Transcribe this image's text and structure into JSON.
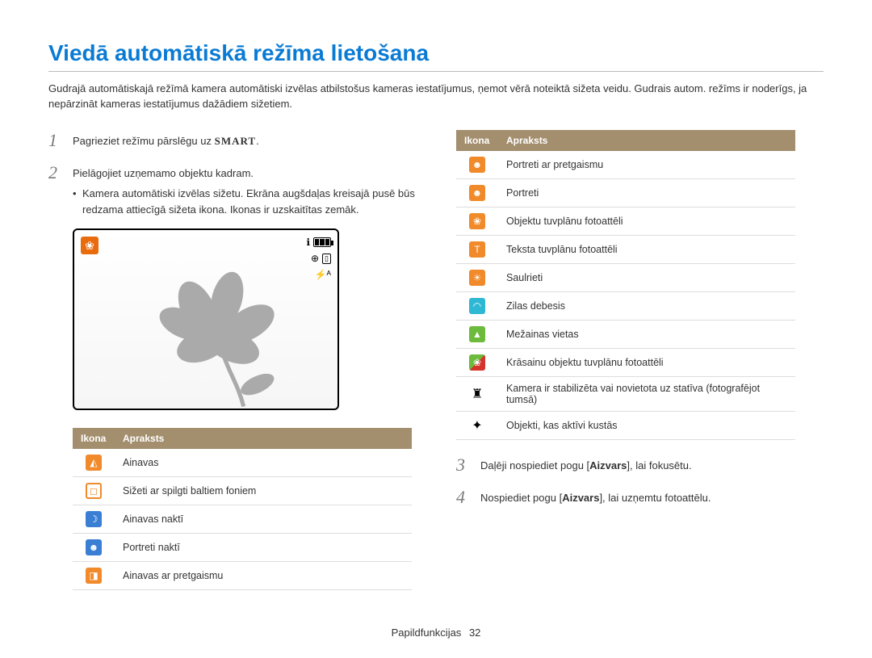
{
  "title": "Viedā automātiskā režīma lietošana",
  "intro": "Gudrajā automātiskajā režīmā kamera automātiski izvēlas atbilstošus kameras iestatījumus, ņemot vērā noteiktā sižeta veidu. Gudrais autom. režīms ir noderīgs, ja nepārzināt kameras iestatījumus dažādiem sižetiem.",
  "steps": {
    "s1_pre": "Pagrieziet režīmu pārslēgu uz ",
    "s1_smart": "SMART",
    "s1_post": ".",
    "s2": "Pielāgojiet uzņemamo objektu kadram.",
    "s2_sub": "Kamera automātiski izvēlas sižetu. Ekrāna augšdaļas kreisajā pusē būs redzama attiecīgā sižeta ikona. Ikonas ir uzskaitītas zemāk.",
    "s3_a": "Daļēji nospiediet pogu [",
    "s3_b": "Aizvars",
    "s3_c": "], lai fokusētu.",
    "s4_a": "Nospiediet pogu [",
    "s4_b": "Aizvars",
    "s4_c": "], lai uzņemtu fotoattēlu."
  },
  "table_headers": {
    "icon": "Ikona",
    "desc": "Apraksts"
  },
  "left_rows": [
    {
      "glyph": "◭",
      "cls": "ic-orange",
      "text": "Ainavas"
    },
    {
      "glyph": "◻",
      "cls": "ic-orange-border",
      "text": "Sižeti ar spilgti baltiem foniem"
    },
    {
      "glyph": "☽",
      "cls": "ic-blue",
      "text": "Ainavas naktī"
    },
    {
      "glyph": "☻",
      "cls": "ic-blue",
      "text": "Portreti naktī"
    },
    {
      "glyph": "◨",
      "cls": "ic-orange",
      "text": "Ainavas ar pretgaismu"
    }
  ],
  "right_rows": [
    {
      "glyph": "☻",
      "cls": "ic-orange",
      "text": "Portreti ar pretgaismu"
    },
    {
      "glyph": "☻",
      "cls": "ic-orange",
      "text": "Portreti"
    },
    {
      "glyph": "❀",
      "cls": "ic-orange",
      "text": "Objektu tuvplānu fotoattēli"
    },
    {
      "glyph": "T",
      "cls": "ic-orange",
      "text": "Teksta tuvplānu fotoattēli"
    },
    {
      "glyph": "☀",
      "cls": "ic-orange",
      "text": "Saulrieti"
    },
    {
      "glyph": "◠",
      "cls": "ic-cyan",
      "text": "Zilas debesis"
    },
    {
      "glyph": "▲",
      "cls": "ic-green",
      "text": "Mežainas vietas"
    },
    {
      "glyph": "❀",
      "cls": "ic-greenred",
      "text": "Krāsainu objektu tuvplānu fotoattēli"
    },
    {
      "glyph": "♜",
      "cls": "ic-black",
      "text": "Kamera ir stabilizēta vai novietota uz statīva (fotografējot tumsā)"
    },
    {
      "glyph": "✦",
      "cls": "ic-black",
      "text": "Objekti, kas aktīvi kustās"
    }
  ],
  "footer": {
    "section": "Papildfunkcijas",
    "page": "32"
  }
}
